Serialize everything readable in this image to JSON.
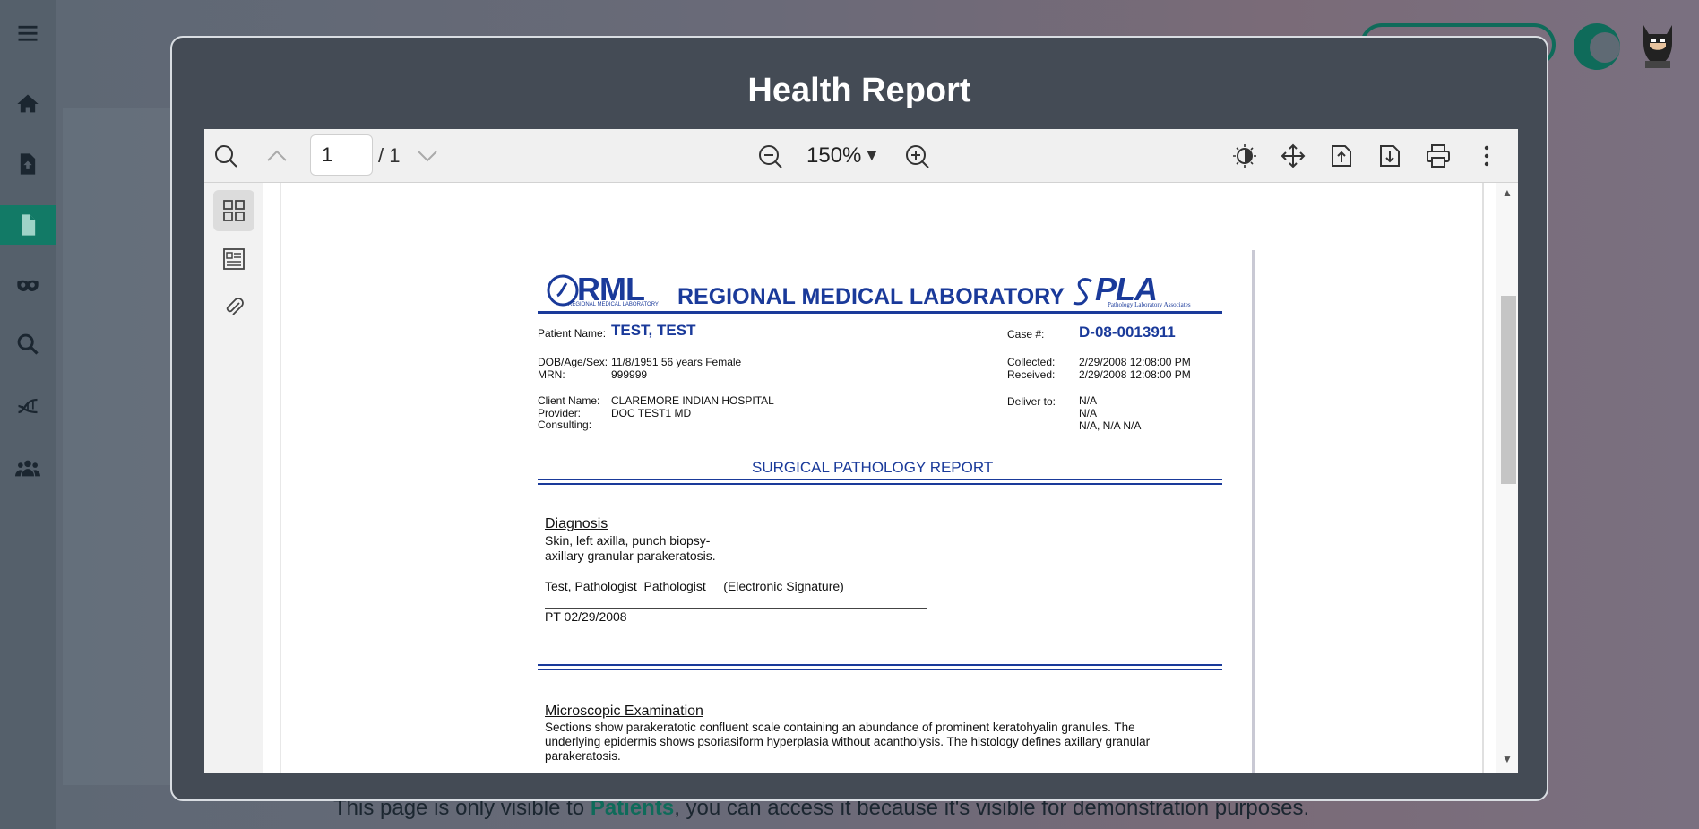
{
  "background": {
    "notice_text_before": "This page is only visible to ",
    "notice_highlight": "Patients",
    "notice_text_after": ", you can access it because it's visible for demonstration purposes.",
    "accent_color": "#0f6b5a"
  },
  "sidebar": {
    "items": [
      {
        "icon": "menu-icon"
      },
      {
        "icon": "home-icon"
      },
      {
        "icon": "file-upload-icon"
      },
      {
        "icon": "document-icon",
        "active": true
      },
      {
        "icon": "mask-icon"
      },
      {
        "icon": "search-icon"
      },
      {
        "icon": "dna-icon"
      },
      {
        "icon": "users-icon"
      }
    ]
  },
  "modal": {
    "title": "Health Report"
  },
  "pdf_toolbar": {
    "current_page": "1",
    "total_pages": "/ 1",
    "zoom": "150%",
    "caret": "▼"
  },
  "report": {
    "lab_logo_text": "RML",
    "lab_logo_sub": "REGIONAL MEDICAL LABORATORY",
    "lab_name": "REGIONAL MEDICAL LABORATORY",
    "partner_logo_text": "PLA",
    "partner_logo_sub": "Pathology Laboratory Associates",
    "patient_name_label": "Patient Name:",
    "patient_name": "TEST, TEST",
    "case_label": "Case #:",
    "case_number": "D-08-0013911",
    "dob_label": "DOB/Age/Sex:",
    "dob_value": "11/8/1951  56 years  Female",
    "mrn_label": "MRN:",
    "mrn_value": "999999",
    "collected_label": "Collected:",
    "collected_value": "2/29/2008 12:08:00 PM",
    "received_label": "Received:",
    "received_value": "2/29/2008 12:08:00 PM",
    "client_label": "Client Name:",
    "client_value": "CLAREMORE INDIAN HOSPITAL",
    "provider_label": "Provider:",
    "provider_value": "DOC TEST1 MD",
    "consulting_label": "Consulting:",
    "deliver_label": "Deliver to:",
    "deliver_line1": "N/A",
    "deliver_line2": "N/A",
    "deliver_line3": "N/A, N/A  N/A",
    "report_title": "SURGICAL PATHOLOGY REPORT",
    "diagnosis_heading": "Diagnosis",
    "diagnosis_line1": "Skin, left axilla, punch biopsy-",
    "diagnosis_line2": "axillary granular parakeratosis.",
    "signature_line": "Test, Pathologist  Pathologist     (Electronic Signature)",
    "pt_line": "PT  02/29/2008",
    "micro_heading": "Microscopic Examination",
    "micro_line1": "Sections show parakeratotic confluent scale containing an abundance of prominent keratohyalin granules. The",
    "micro_line2": "underlying epidermis shows psoriasiform hyperplasia without acantholysis. The histology defines axillary granular",
    "micro_line3": "parakeratosis."
  }
}
